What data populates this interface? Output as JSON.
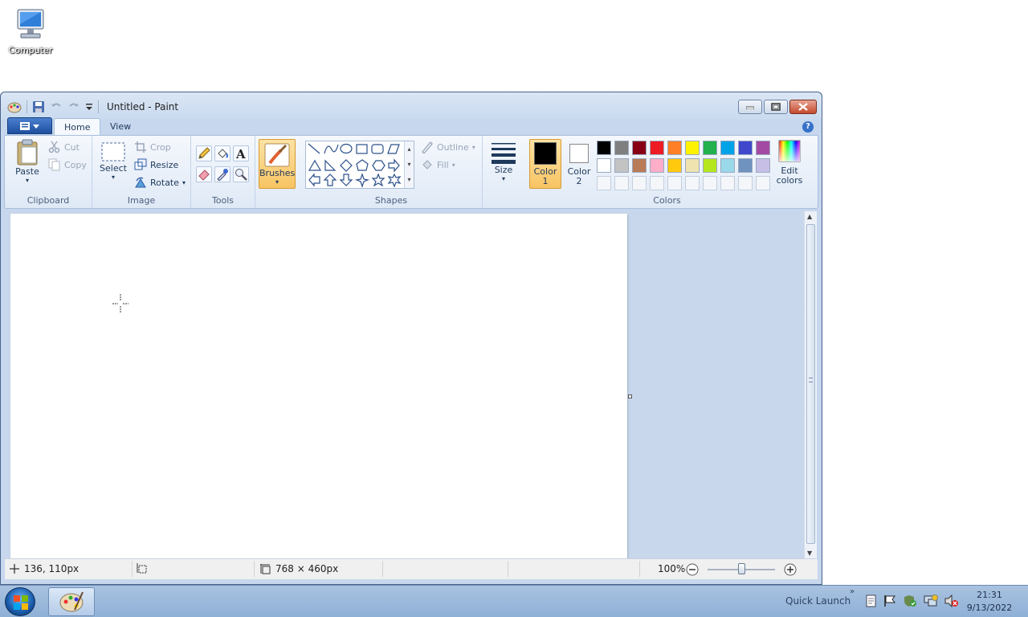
{
  "desktop": {
    "computer_label": "Computer"
  },
  "window": {
    "title": "Untitled - Paint"
  },
  "tabs": [
    {
      "label": "Home"
    },
    {
      "label": "View"
    }
  ],
  "ribbon": {
    "clipboard": {
      "paste": "Paste",
      "cut": "Cut",
      "copy": "Copy",
      "group": "Clipboard"
    },
    "image": {
      "select": "Select",
      "crop": "Crop",
      "resize": "Resize",
      "rotate": "Rotate",
      "group": "Image"
    },
    "tools": {
      "group": "Tools"
    },
    "brushes": {
      "label": "Brushes"
    },
    "shapes": {
      "outline": "Outline",
      "fill": "Fill",
      "group": "Shapes"
    },
    "size": {
      "label": "Size"
    },
    "colors": {
      "color1_a": "Color",
      "color1_b": "1",
      "color2_a": "Color",
      "color2_b": "2",
      "edit_a": "Edit",
      "edit_b": "colors",
      "group": "Colors",
      "row1": [
        "#000000",
        "#7f7f7f",
        "#880015",
        "#ed1c24",
        "#ff7f27",
        "#fff200",
        "#22b14c",
        "#00a2e8",
        "#3f48cc",
        "#a349a4"
      ],
      "row2": [
        "#ffffff",
        "#c3c3c3",
        "#b97a57",
        "#ffaec9",
        "#ffc90e",
        "#efe4b0",
        "#b5e61d",
        "#99d9ea",
        "#7092be",
        "#c8bfe7"
      ],
      "color1": "#000000",
      "color2": "#ffffff"
    }
  },
  "status": {
    "position": "136, 110px",
    "canvas_size": "768 × 460px",
    "zoom": "100%"
  },
  "taskbar": {
    "quick_launch": "Quick Launch",
    "time": "21:31",
    "date": "9/13/2022"
  }
}
